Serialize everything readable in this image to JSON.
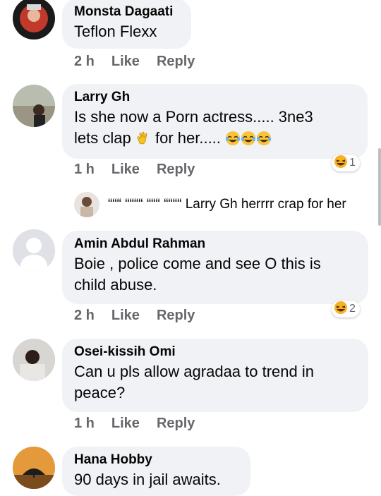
{
  "comments": [
    {
      "author": "Monsta Dagaati",
      "text": "Teflon Flexx",
      "time": "2 h",
      "like": "Like",
      "reply": "Reply"
    },
    {
      "author": "Larry Gh",
      "text_line1": "Is she now a Porn actress..... 3ne3",
      "text_line2a": "lets clap",
      "text_line2b": "for her.....",
      "time": "1 h",
      "like": "Like",
      "reply": "Reply",
      "reaction_count": "1"
    },
    {
      "author": "Amin Abdul Rahman",
      "text_line1": "Boie , police come and see O this is",
      "text_line2": "child abuse.",
      "time": "2 h",
      "like": "Like",
      "reply": "Reply",
      "reaction_count": "2"
    },
    {
      "author": "Osei-kissih Omi",
      "text_line1": "Can u pls allow agradaa to trend in",
      "text_line2": "peace?",
      "time": "1 h",
      "like": "Like",
      "reply": "Reply"
    },
    {
      "author": "Hana Hobby",
      "text": "90 days in jail awaits."
    }
  ],
  "reply_preview": {
    "text": "“““ ““““ “““ ““““ Larry Gh herrrr crap for her"
  },
  "icons": {
    "clap": "clapping-hands-emoji",
    "laugh": "tears-of-joy-emoji",
    "haha": "haha-reaction-icon"
  }
}
